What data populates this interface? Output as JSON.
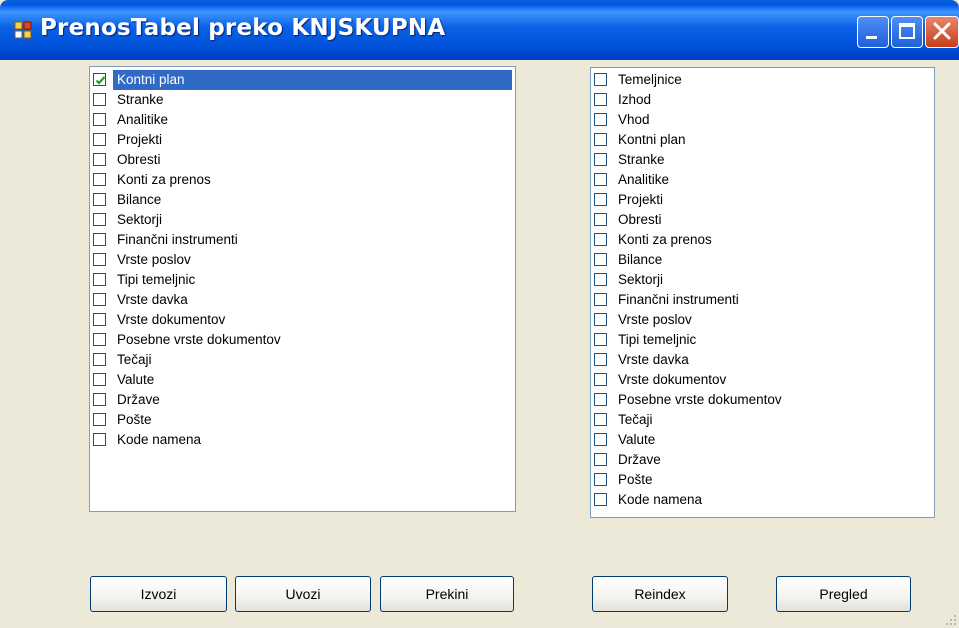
{
  "window": {
    "title": "PrenosTabel preko KNJSKUPNA"
  },
  "icons": {
    "app": "app-icon",
    "minimize": "minimize-icon",
    "maximize": "maximize-icon",
    "close": "close-icon",
    "checkmark": "checkmark-icon"
  },
  "colors": {
    "titlebar": "#0a5fd8",
    "selection": "#316ac5",
    "window_bg": "#ece9d8",
    "checkmark": "#21a121"
  },
  "left_list": {
    "items": [
      {
        "label": "Kontni plan",
        "checked": true,
        "selected": true
      },
      {
        "label": "Stranke",
        "checked": false
      },
      {
        "label": "Analitike",
        "checked": false
      },
      {
        "label": "Projekti",
        "checked": false
      },
      {
        "label": "Obresti",
        "checked": false
      },
      {
        "label": "Konti za prenos",
        "checked": false
      },
      {
        "label": "Bilance",
        "checked": false
      },
      {
        "label": "Sektorji",
        "checked": false
      },
      {
        "label": "Finančni instrumenti",
        "checked": false
      },
      {
        "label": "Vrste poslov",
        "checked": false
      },
      {
        "label": "Tipi temeljnic",
        "checked": false
      },
      {
        "label": "Vrste davka",
        "checked": false
      },
      {
        "label": "Vrste dokumentov",
        "checked": false
      },
      {
        "label": "Posebne vrste dokumentov",
        "checked": false
      },
      {
        "label": "Tečaji",
        "checked": false
      },
      {
        "label": "Valute",
        "checked": false
      },
      {
        "label": "Države",
        "checked": false
      },
      {
        "label": "Pošte",
        "checked": false
      },
      {
        "label": "Kode namena",
        "checked": false
      }
    ]
  },
  "right_list": {
    "items": [
      {
        "label": "Temeljnice",
        "checked": false
      },
      {
        "label": "Izhod",
        "checked": false
      },
      {
        "label": "Vhod",
        "checked": false
      },
      {
        "label": "Kontni plan",
        "checked": false
      },
      {
        "label": "Stranke",
        "checked": false
      },
      {
        "label": "Analitike",
        "checked": false
      },
      {
        "label": "Projekti",
        "checked": false
      },
      {
        "label": "Obresti",
        "checked": false
      },
      {
        "label": "Konti za prenos",
        "checked": false
      },
      {
        "label": "Bilance",
        "checked": false
      },
      {
        "label": "Sektorji",
        "checked": false
      },
      {
        "label": "Finančni instrumenti",
        "checked": false
      },
      {
        "label": "Vrste poslov",
        "checked": false
      },
      {
        "label": "Tipi temeljnic",
        "checked": false
      },
      {
        "label": "Vrste davka",
        "checked": false
      },
      {
        "label": "Vrste dokumentov",
        "checked": false
      },
      {
        "label": "Posebne vrste dokumentov",
        "checked": false
      },
      {
        "label": "Tečaji",
        "checked": false
      },
      {
        "label": "Valute",
        "checked": false
      },
      {
        "label": "Države",
        "checked": false
      },
      {
        "label": "Pošte",
        "checked": false
      },
      {
        "label": "Kode namena",
        "checked": false
      }
    ]
  },
  "buttons": {
    "izvozi": "Izvozi",
    "uvozi": "Uvozi",
    "prekini": "Prekini",
    "reindex": "Reindex",
    "pregled": "Pregled"
  }
}
